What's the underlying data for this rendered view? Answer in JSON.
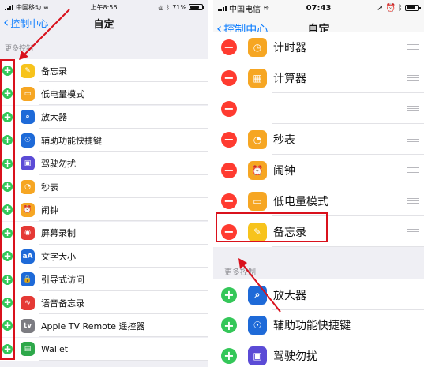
{
  "left_screen": {
    "status_bar": {
      "carrier": "中国移动",
      "time": "上午8:56",
      "battery": "71%"
    },
    "nav": {
      "back_label": "控制中心",
      "title": "自定"
    },
    "section_header": "更多控制",
    "items": [
      {
        "label": "备忘录",
        "icon": "notes-icon",
        "icon_glyph": "✎",
        "color": "#f7c31c"
      },
      {
        "label": "低电量模式",
        "icon": "low-power-icon",
        "icon_glyph": "▭",
        "color": "#f6a623"
      },
      {
        "label": "放大器",
        "icon": "magnifier-icon",
        "icon_glyph": "⌕",
        "color": "#1e6ad8"
      },
      {
        "label": "辅助功能快捷键",
        "icon": "accessibility-icon",
        "icon_glyph": "☉",
        "color": "#1e6ad8"
      },
      {
        "label": "驾驶勿扰",
        "icon": "car-icon",
        "icon_glyph": "▣",
        "color": "#5b4bd6"
      },
      {
        "label": "秒表",
        "icon": "stopwatch-icon",
        "icon_glyph": "◔",
        "color": "#f6a623"
      },
      {
        "label": "闹钟",
        "icon": "alarm-icon",
        "icon_glyph": "⏰",
        "color": "#f6a623"
      },
      {
        "label": "屏幕录制",
        "icon": "screen-record-icon",
        "icon_glyph": "◉",
        "color": "#e53935"
      },
      {
        "label": "文字大小",
        "icon": "text-size-icon",
        "icon_glyph": "aA",
        "color": "#1e6ad8"
      },
      {
        "label": "引导式访问",
        "icon": "lock-icon",
        "icon_glyph": "🔒",
        "color": "#1e6ad8"
      },
      {
        "label": "语音备忘录",
        "icon": "voice-memo-icon",
        "icon_glyph": "∿",
        "color": "#e53935"
      },
      {
        "label": "Apple TV Remote 遥控器",
        "icon": "apple-tv-icon",
        "icon_glyph": "tv",
        "color": "#7c7c82"
      },
      {
        "label": "Wallet",
        "icon": "wallet-icon",
        "icon_glyph": "▤",
        "color": "#2ea84a"
      }
    ]
  },
  "right_screen": {
    "status_bar": {
      "carrier": "中国电信",
      "time": "07:43"
    },
    "nav": {
      "back_label": "控制中心",
      "title": "自定"
    },
    "included_items": [
      {
        "label": "计时器",
        "icon": "timer-icon",
        "icon_glyph": "◷",
        "color": "#f6a623"
      },
      {
        "label": "计算器",
        "icon": "calculator-icon",
        "icon_glyph": "▦",
        "color": "#f6a623"
      },
      {
        "label": "",
        "icon": "hidden-icon",
        "icon_glyph": "",
        "color": "#ffffff"
      },
      {
        "label": "秒表",
        "icon": "stopwatch-icon",
        "icon_glyph": "◔",
        "color": "#f6a623"
      },
      {
        "label": "闹钟",
        "icon": "alarm-icon",
        "icon_glyph": "⏰",
        "color": "#f6a623"
      },
      {
        "label": "低电量模式",
        "icon": "low-power-icon",
        "icon_glyph": "▭",
        "color": "#f6a623"
      },
      {
        "label": "备忘录",
        "icon": "notes-icon",
        "icon_glyph": "✎",
        "color": "#f7c31c"
      }
    ],
    "section_header": "更多控制",
    "more_items": [
      {
        "label": "放大器",
        "icon": "magnifier-icon",
        "icon_glyph": "⌕",
        "color": "#1e6ad8"
      },
      {
        "label": "辅助功能快捷键",
        "icon": "accessibility-icon",
        "icon_glyph": "☉",
        "color": "#1e6ad8"
      },
      {
        "label": "驾驶勿扰",
        "icon": "car-icon",
        "icon_glyph": "▣",
        "color": "#5b4bd6"
      }
    ]
  },
  "colors": {
    "add": "#34c759",
    "remove": "#ff3b30",
    "link": "#0a7cff",
    "annotation": "#d9111c"
  },
  "glyphs": {
    "add": "+",
    "remove": "−",
    "back": "‹"
  }
}
